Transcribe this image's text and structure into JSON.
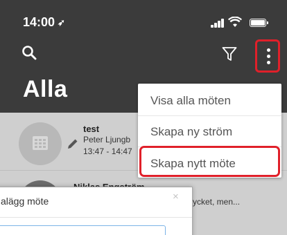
{
  "status_bar": {
    "time": "14:00",
    "location_glyph": "➶"
  },
  "header": {
    "title": "Alla"
  },
  "icons": {
    "search": "search-icon",
    "filter": "filter-icon",
    "more": "more-vertical-icon",
    "edit": "pencil-icon",
    "calendar": "calendar-icon",
    "location": "location-arrow-icon"
  },
  "list": {
    "items": [
      {
        "title": "test",
        "subtitle": "Peter Ljungb",
        "time": "13:47 - 14:47"
      },
      {
        "title": "Niklas Engström",
        "snippet": "å mycket, men..."
      }
    ]
  },
  "menu": {
    "items": [
      {
        "label": "Visa alla möten"
      },
      {
        "label": "Skapa ny ström"
      },
      {
        "label": "Skapa nytt möte"
      }
    ]
  },
  "dialog": {
    "title": "alägg möte",
    "close": "×",
    "input_value": ""
  },
  "colors": {
    "header_bg": "#3b3b3b",
    "list_bg": "#cfcfcf",
    "highlight": "#e0202a",
    "input_border": "#7ab3e6"
  }
}
